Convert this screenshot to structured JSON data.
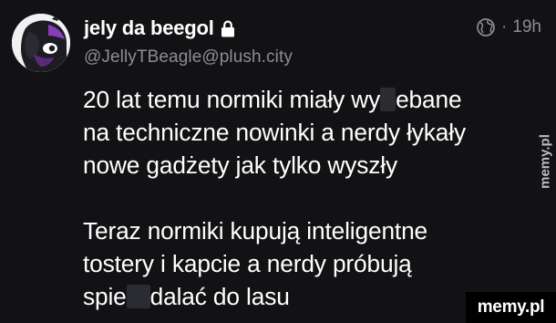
{
  "post": {
    "author": {
      "display_name": "jely da beegol",
      "handle": "@JellyTBeagle@plush.city",
      "avatar_icon": "beagle-avatar",
      "locked": true
    },
    "meta": {
      "visibility_icon": "globe-icon",
      "separator": "·",
      "time": "19h"
    },
    "body": {
      "p1_l1_a": "20 lat temu normiki miały wy",
      "p1_l1_b": "ebane",
      "p1_l2": "na techniczne nowinki a nerdy łykały",
      "p1_l3": "nowe gadżety jak tylko wyszły",
      "p2_l1": "Teraz normiki kupują inteligentne",
      "p2_l2": "tostery i kapcie a nerdy próbują",
      "p2_l3_a": "spie",
      "p2_l3_b": "dalać do lasu"
    }
  },
  "watermarks": {
    "side": "memy.pl",
    "corner": "memy.pl"
  },
  "colors": {
    "background": "#121215",
    "text": "#ffffff",
    "muted": "#8a8d96",
    "censor_box": "#2b2c31"
  }
}
